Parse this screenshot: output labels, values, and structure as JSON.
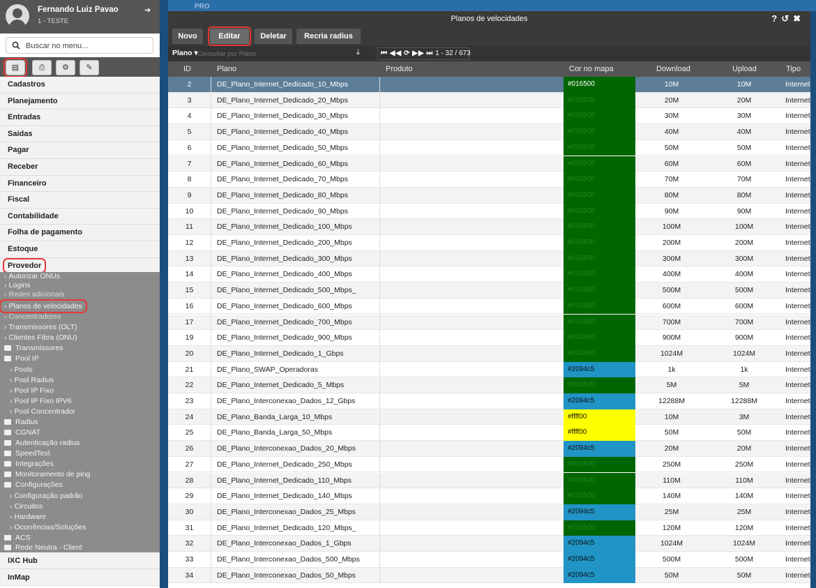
{
  "user": {
    "name": "Fernando Luiz Pavao",
    "sub": "1 - TESTE"
  },
  "search": {
    "placeholder": "Buscar no menu..."
  },
  "menu": [
    "Cadastros",
    "Planejamento",
    "Entradas",
    "Saidas",
    "Pagar",
    "Receber",
    "Financeiro",
    "Fiscal",
    "Contabilidade",
    "Folha de pagamento",
    "Estoque",
    "Provedor"
  ],
  "submenu": {
    "autorizar": "Autorizar ONUs",
    "logins": "Logins",
    "redes": "Redes adicionais",
    "planos": "Planos de velocidades",
    "concentradores": "Concentradores",
    "transmissores_olt": "Transmissores (OLT)",
    "clientes_fibra": "Clientes Fibra (ONU)",
    "transmissores": "Transmissores",
    "pool_ip": "Pool IP",
    "pools": "Pools",
    "pool_radius": "Pool Radius",
    "pool_ip_fixo": "Pool IP Fixo",
    "pool_ip_fixo_ipv6": "Pool IP Fixo IPV6",
    "pool_concentrador": "Pool Concentrador",
    "radius": "Radius",
    "cgnat": "CGNAT",
    "autenticacao": "Autenticação radius",
    "speedtest": "SpeedTest",
    "integracoes": "Integrações",
    "monitoramento": "Monitoramento de ping",
    "configuracoes": "Configurações",
    "config_padrao": "Configuração padrão",
    "circuitos": "Circuitos",
    "hardware": "Hardware",
    "ocorrencias": "Ocorrências/Soluções",
    "acs": "ACS",
    "rede_neutra": "Rede Neutra - Client"
  },
  "bottom_menu": [
    "IXC Hub",
    "InMap"
  ],
  "background_tab": "PRO",
  "window": {
    "title": "Planos de velocidades",
    "buttons": {
      "novo": "Novo",
      "editar": "Editar",
      "deletar": "Deletar",
      "recria": "Recria radius"
    },
    "filter": {
      "label": "Plano ▾",
      "placeholder": "Consultar por Plano"
    },
    "pager": {
      "range": "1 - 32 / 673"
    },
    "columns": {
      "id": "ID",
      "plano": "Plano",
      "produto": "Produto",
      "cor": "Cor no mapa",
      "download": "Download",
      "upload": "Upload",
      "tipo": "Tipo"
    }
  },
  "colors": {
    "green": "#016500",
    "blue": "#2094c5",
    "yellow": "#ffff00"
  },
  "rows": [
    {
      "id": "2",
      "plano": "DE_Plano_Internet_Dedicado_10_Mbps",
      "cor": "#016500",
      "down": "10M",
      "up": "10M",
      "tipo": "Internet"
    },
    {
      "id": "3",
      "plano": "DE_Plano_Internet_Dedicado_20_Mbps",
      "cor": "#016500",
      "down": "20M",
      "up": "20M",
      "tipo": "Internet"
    },
    {
      "id": "4",
      "plano": "DE_Plano_Internet_Dedicado_30_Mbps",
      "cor": "#016500",
      "down": "30M",
      "up": "30M",
      "tipo": "Internet"
    },
    {
      "id": "5",
      "plano": "DE_Plano_Internet_Dedicado_40_Mbps",
      "cor": "#016500",
      "down": "40M",
      "up": "40M",
      "tipo": "Internet"
    },
    {
      "id": "6",
      "plano": "DE_Plano_Internet_Dedicado_50_Mbps",
      "cor": "#016500",
      "down": "50M",
      "up": "50M",
      "tipo": "Internet"
    },
    {
      "id": "7",
      "plano": "DE_Plano_Internet_Dedicado_60_Mbps",
      "cor": "#016500",
      "down": "60M",
      "up": "60M",
      "tipo": "Internet"
    },
    {
      "id": "8",
      "plano": "DE_Plano_Internet_Dedicado_70_Mbps",
      "cor": "#016500",
      "down": "70M",
      "up": "70M",
      "tipo": "Internet"
    },
    {
      "id": "9",
      "plano": "DE_Plano_Internet_Dedicado_80_Mbps",
      "cor": "#016500",
      "down": "80M",
      "up": "80M",
      "tipo": "Internet"
    },
    {
      "id": "10",
      "plano": "DE_Plano_Internet_Dedicado_90_Mbps",
      "cor": "#016500",
      "down": "90M",
      "up": "90M",
      "tipo": "Internet"
    },
    {
      "id": "11",
      "plano": "DE_Plano_Internet_Dedicado_100_Mbps",
      "cor": "#016500",
      "down": "100M",
      "up": "100M",
      "tipo": "Internet"
    },
    {
      "id": "12",
      "plano": "DE_Plano_Internet_Dedicado_200_Mbps",
      "cor": "#016500",
      "down": "200M",
      "up": "200M",
      "tipo": "Internet"
    },
    {
      "id": "13",
      "plano": "DE_Plano_Internet_Dedicado_300_Mbps",
      "cor": "#016500",
      "down": "300M",
      "up": "300M",
      "tipo": "Internet"
    },
    {
      "id": "14",
      "plano": "DE_Plano_Internet_Dedicado_400_Mbps",
      "cor": "#016500",
      "down": "400M",
      "up": "400M",
      "tipo": "Internet"
    },
    {
      "id": "15",
      "plano": "DE_Plano_Internet_Dedicado_500_Mbps_",
      "cor": "#016500",
      "down": "500M",
      "up": "500M",
      "tipo": "Internet"
    },
    {
      "id": "16",
      "plano": "DE_Plano_Internet_Dedicado_600_Mbps",
      "cor": "#016500",
      "down": "600M",
      "up": "600M",
      "tipo": "Internet"
    },
    {
      "id": "17",
      "plano": "DE_Plano_Internet_Dedicado_700_Mbps",
      "cor": "#016500",
      "down": "700M",
      "up": "700M",
      "tipo": "Internet"
    },
    {
      "id": "19",
      "plano": "DE_Plano_Internet_Dedicado_900_Mbps",
      "cor": "#016500",
      "down": "900M",
      "up": "900M",
      "tipo": "Internet"
    },
    {
      "id": "20",
      "plano": "DE_Plano_Internet_Dedicado_1_Gbps",
      "cor": "#016500",
      "down": "1024M",
      "up": "1024M",
      "tipo": "Internet"
    },
    {
      "id": "21",
      "plano": "DE_Plano_SWAP_Operadoras",
      "cor": "#2094c5",
      "down": "1k",
      "up": "1k",
      "tipo": "Internet"
    },
    {
      "id": "22",
      "plano": "DE_Plano_Internet_Dedicado_5_Mbps",
      "cor": "#016500",
      "down": "5M",
      "up": "5M",
      "tipo": "Internet"
    },
    {
      "id": "23",
      "plano": "DE_Plano_Interconexao_Dados_12_Gbps",
      "cor": "#2094c5",
      "down": "12288M",
      "up": "12288M",
      "tipo": "Internet"
    },
    {
      "id": "24",
      "plano": "DE_Plano_Banda_Larga_10_Mbps",
      "cor": "#ffff00",
      "down": "10M",
      "up": "3M",
      "tipo": "Internet"
    },
    {
      "id": "25",
      "plano": "DE_Plano_Banda_Larga_50_Mbps",
      "cor": "#ffff00",
      "down": "50M",
      "up": "50M",
      "tipo": "Internet"
    },
    {
      "id": "26",
      "plano": "DE_Plano_Interconexao_Dados_20_Mbps",
      "cor": "#2094c5",
      "down": "20M",
      "up": "20M",
      "tipo": "Internet"
    },
    {
      "id": "27",
      "plano": "DE_Plano_Internet_Dedicado_250_Mbps",
      "cor": "#016500",
      "down": "250M",
      "up": "250M",
      "tipo": "Internet"
    },
    {
      "id": "28",
      "plano": "DE_Plano_Internet_Dedicado_110_Mbps",
      "cor": "#016500",
      "down": "110M",
      "up": "110M",
      "tipo": "Internet"
    },
    {
      "id": "29",
      "plano": "DE_Plano_Internet_Dedicado_140_Mbps",
      "cor": "#016500",
      "down": "140M",
      "up": "140M",
      "tipo": "Internet"
    },
    {
      "id": "30",
      "plano": "DE_Plano_Interconexao_Dados_25_Mbps",
      "cor": "#2094c5",
      "down": "25M",
      "up": "25M",
      "tipo": "Internet"
    },
    {
      "id": "31",
      "plano": "DE_Plano_Internet_Dedicado_120_Mbps_",
      "cor": "#016500",
      "down": "120M",
      "up": "120M",
      "tipo": "Internet"
    },
    {
      "id": "32",
      "plano": "DE_Plano_Interconexao_Dados_1_Gbps",
      "cor": "#2094c5",
      "down": "1024M",
      "up": "1024M",
      "tipo": "Internet"
    },
    {
      "id": "33",
      "plano": "DE_Plano_Interconexao_Dados_500_Mbps",
      "cor": "#2094c5",
      "down": "500M",
      "up": "500M",
      "tipo": "Internet"
    },
    {
      "id": "34",
      "plano": "DE_Plano_Interconexao_Dados_50_Mbps",
      "cor": "#2094c5",
      "down": "50M",
      "up": "50M",
      "tipo": "Internet"
    }
  ],
  "selected_row": 0
}
